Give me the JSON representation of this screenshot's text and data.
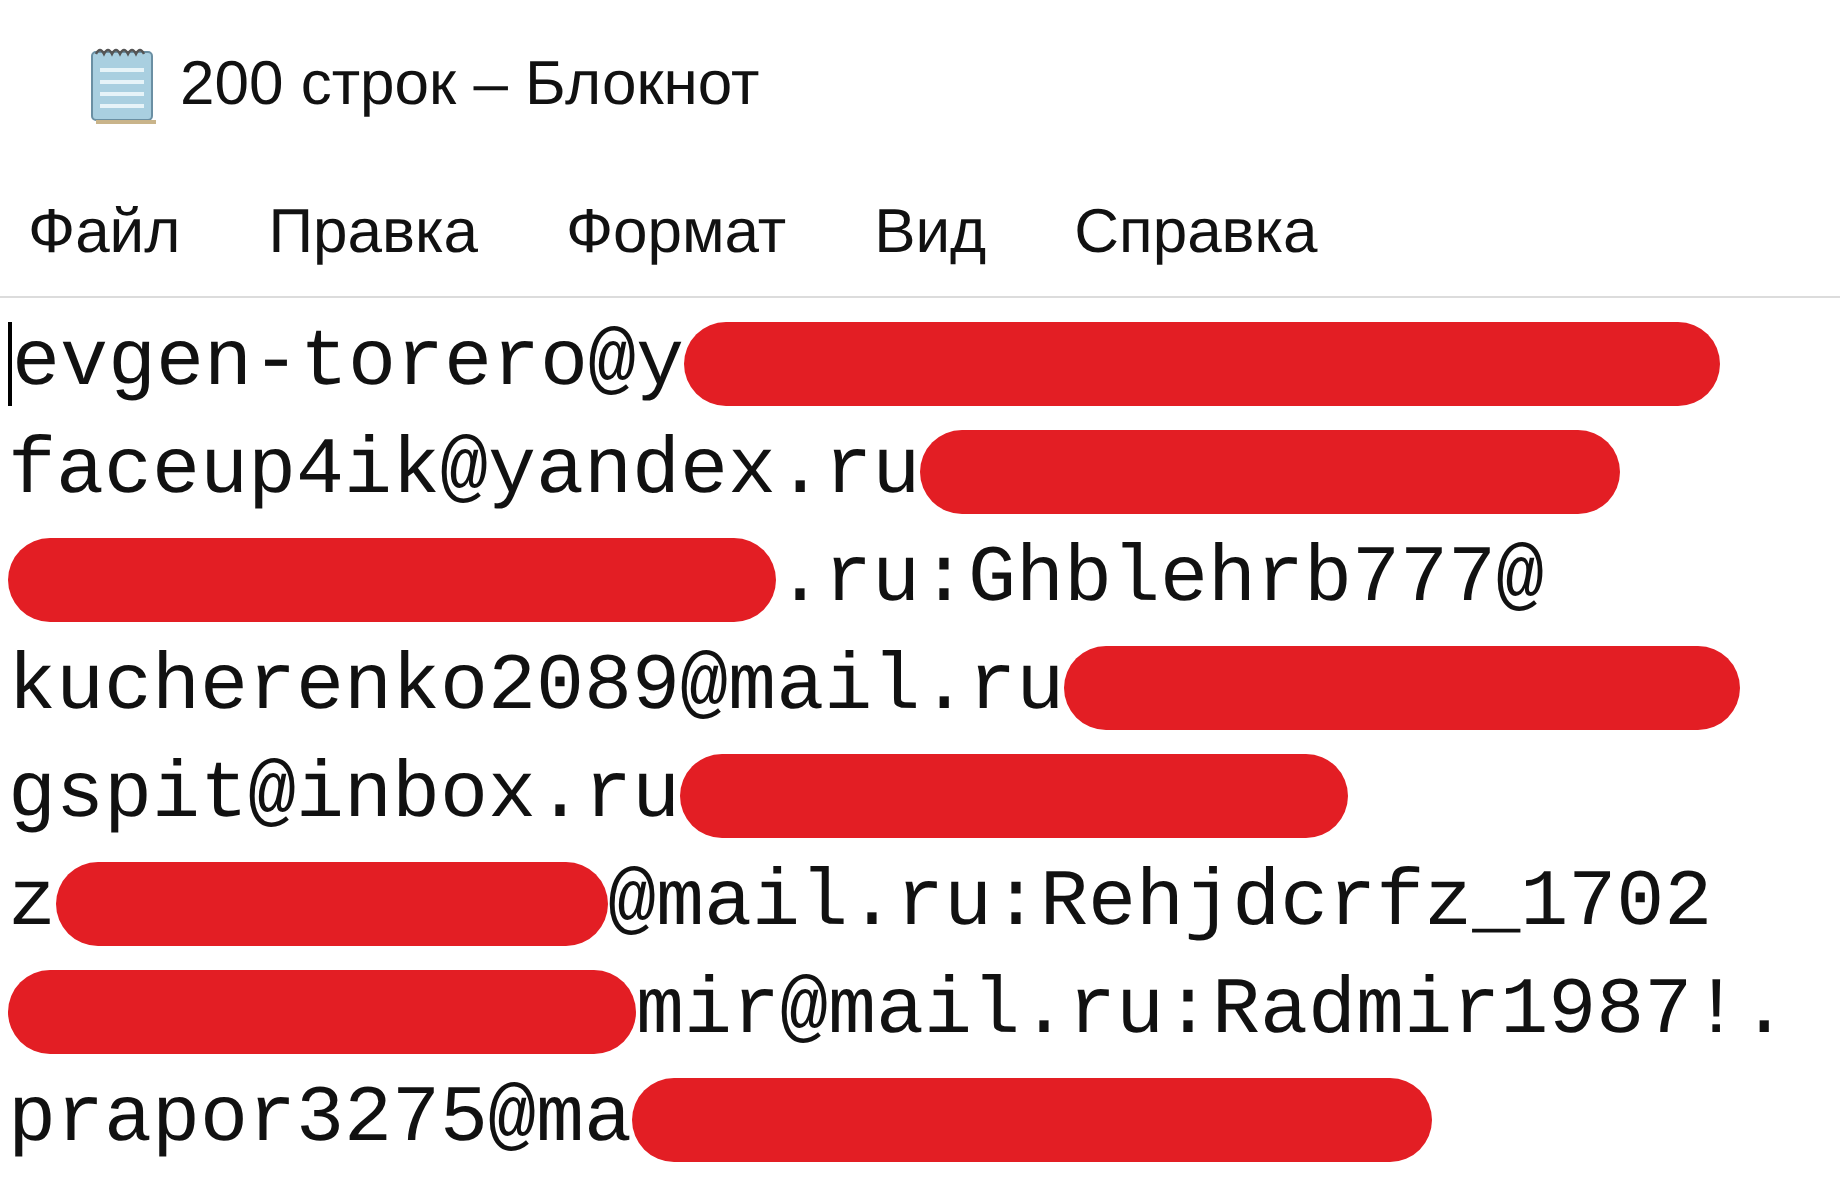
{
  "window": {
    "title": "200 строк – Блокнот"
  },
  "menu": [
    {
      "label": "Файл"
    },
    {
      "label": "Правка"
    },
    {
      "label": "Формат"
    },
    {
      "label": "Вид"
    },
    {
      "label": "Справка"
    }
  ],
  "editor": {
    "cursor": true,
    "lines": [
      {
        "segments": [
          {
            "kind": "text",
            "text": "evgen-torero@y"
          },
          {
            "kind": "redaction"
          }
        ]
      },
      {
        "segments": [
          {
            "kind": "text",
            "text": "faceup4ik@yandex.ru"
          },
          {
            "kind": "redaction"
          }
        ]
      },
      {
        "segments": [
          {
            "kind": "redaction"
          },
          {
            "kind": "text",
            "text": ".ru:Ghblehrb777@"
          }
        ]
      },
      {
        "segments": [
          {
            "kind": "text",
            "text": "kucherenko2089@mail.ru"
          },
          {
            "kind": "redaction"
          }
        ]
      },
      {
        "segments": [
          {
            "kind": "text",
            "text": "gspit@inbox.ru"
          },
          {
            "kind": "redaction"
          }
        ]
      },
      {
        "segments": [
          {
            "kind": "text",
            "text": "z"
          },
          {
            "kind": "redaction"
          },
          {
            "kind": "text",
            "text": "@mail.ru:Rehjdcrfz_1702"
          }
        ]
      },
      {
        "segments": [
          {
            "kind": "redaction"
          },
          {
            "kind": "text",
            "text": "mir@mail.ru:Radmir1987!."
          }
        ]
      },
      {
        "segments": [
          {
            "kind": "text",
            "text": "prapor3275@ma"
          },
          {
            "kind": "redaction"
          }
        ]
      }
    ]
  }
}
